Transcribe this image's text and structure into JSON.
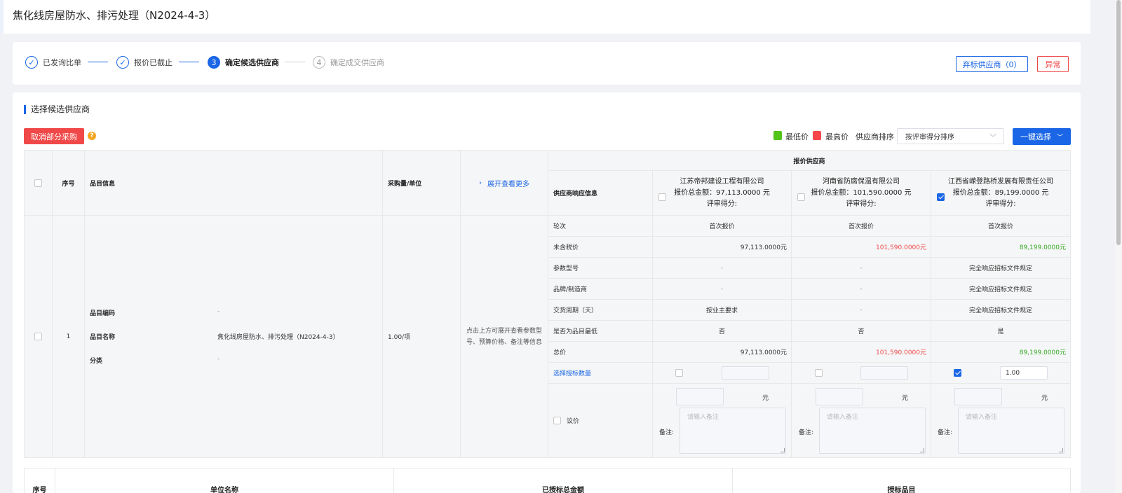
{
  "page": {
    "title": "焦化线房屋防水、排污处理（N2024-4-3）"
  },
  "steps": [
    {
      "num": "✓",
      "label": "已发询比单",
      "state": "done"
    },
    {
      "num": "✓",
      "label": "报价已截止",
      "state": "done"
    },
    {
      "num": "3",
      "label": "确定候选供应商",
      "state": "active"
    },
    {
      "num": "4",
      "label": "确定成交供应商",
      "state": "todo"
    }
  ],
  "header_actions": {
    "abandon_label": "弃标供应商（0）",
    "abnormal_label": "异常"
  },
  "section": {
    "title": "选择候选供应商",
    "cancel_partial_label": "取消部分采购",
    "help_glyph": "?",
    "legend_low": "最低价",
    "legend_high": "最高价",
    "sort_label": "供应商排序",
    "sort_value": "按评审得分排序",
    "one_click_label": "一键选择",
    "colors": {
      "low": "#52c41a",
      "high": "#f5474a",
      "primary": "#1a66e6"
    }
  },
  "table": {
    "headers": {
      "seq": "序号",
      "item_info": "品目信息",
      "qty_unit": "采购量/单位",
      "expand": "展开查看更多",
      "quote_suppliers": "报价供应商",
      "response_info": "供应商响应信息"
    },
    "suppliers": [
      {
        "name": "江苏帝邦建设工程有限公司",
        "total": "报价总金额：97,113.0000 元",
        "score": "评审得分:",
        "checked": false
      },
      {
        "name": "河南省防腐保温有限公司",
        "total": "报价总金额：101,590.0000 元",
        "score": "评审得分:",
        "checked": false
      },
      {
        "name": "江西省嵘登路桥发展有限责任公司",
        "total": "报价总金额：89,199.0000 元",
        "score": "评审得分:",
        "checked": true
      }
    ],
    "row": {
      "seq": "1",
      "code_label": "品目编码",
      "code_value": "-",
      "name_label": "品目名称",
      "name_value": "焦化线房屋防水、排污处理（N2024-4-3）",
      "category_label": "分类",
      "category_value": "-",
      "qty": "1.00/项",
      "expand_hint_1": "点击上方可展开查看参数型",
      "expand_hint_2": "号、预算价格、备注等信息"
    },
    "detail_rows": [
      {
        "label": "轮次",
        "values": [
          "首次报价",
          "首次报价",
          "首次报价"
        ],
        "align": "center"
      },
      {
        "label": "未含税价",
        "values": [
          "97,113.0000元",
          "101,590.0000元",
          "89,199.0000元"
        ],
        "align": "right"
      },
      {
        "label": "参数型号",
        "values": [
          "-",
          "-",
          "完全响应招标文件规定"
        ],
        "align": "center"
      },
      {
        "label": "品牌/制造商",
        "values": [
          "-",
          "-",
          "完全响应招标文件规定"
        ],
        "align": "center"
      },
      {
        "label": "交货周期（天）",
        "values": [
          "按业主要求",
          "-",
          "完全响应招标文件规定"
        ],
        "align": "center"
      },
      {
        "label": "是否为品目最低",
        "values": [
          "否",
          "否",
          "是"
        ],
        "align": "center"
      },
      {
        "label": "总价",
        "values": [
          "97,113.0000元",
          "101,590.0000元",
          "89,199.0000元"
        ],
        "align": "right"
      }
    ],
    "select_qty_label": "选择授标数量",
    "select_qty_values": [
      "",
      "",
      "1.00"
    ],
    "negotiate_label": "议价",
    "yuan": "元",
    "remark_label": "备注:",
    "remark_placeholder": "请输入备注"
  },
  "bottom_table": {
    "headers": [
      "序号",
      "单位名称",
      "已授标总金额",
      "授标品目"
    ]
  }
}
